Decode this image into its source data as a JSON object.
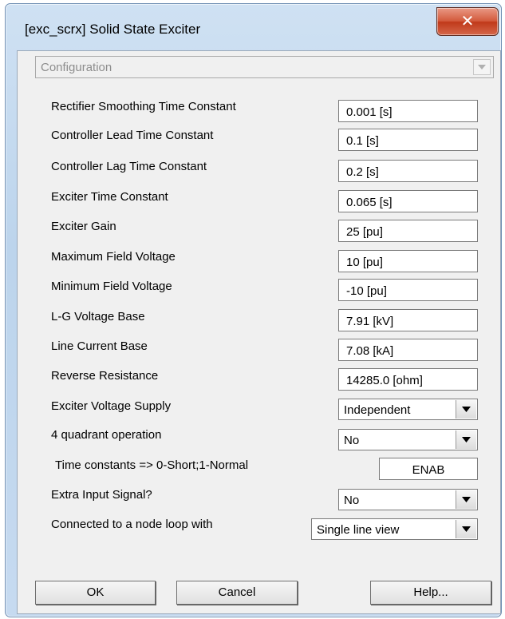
{
  "window": {
    "title": "[exc_scrx] Solid State Exciter",
    "close_glyph": "✕"
  },
  "config": {
    "label": "Configuration",
    "icon": "chevron-down-icon"
  },
  "params": [
    {
      "label": "Rectifier Smoothing Time Constant",
      "value": "0.001 [s]"
    },
    {
      "label": "Controller Lead Time Constant",
      "value": "0.1 [s]"
    },
    {
      "label": "Controller Lag Time Constant",
      "value": "0.2 [s]"
    },
    {
      "label": "Exciter Time Constant",
      "value": "0.065 [s]"
    },
    {
      "label": "Exciter Gain",
      "value": "25 [pu]"
    },
    {
      "label": "Maximum Field Voltage",
      "value": "10 [pu]"
    },
    {
      "label": "Minimum Field Voltage",
      "value": "-10 [pu]"
    },
    {
      "label": "L-G Voltage Base",
      "value": "7.91 [kV]"
    },
    {
      "label": "Line Current Base",
      "value": "7.08 [kA]"
    },
    {
      "label": "Reverse Resistance",
      "value": "14285.0 [ohm]"
    }
  ],
  "selects": {
    "exciter_voltage_supply": {
      "label": "Exciter Voltage Supply",
      "value": "Independent"
    },
    "four_quadrant": {
      "label": "4 quadrant operation",
      "value": "No"
    },
    "time_constants": {
      "label": "Time constants => 0-Short;1-Normal",
      "value": "ENAB"
    },
    "extra_input": {
      "label": "Extra Input Signal?",
      "value": "No"
    },
    "node_loop": {
      "label": "Connected to a node loop with",
      "value": "Single line view"
    }
  },
  "buttons": {
    "ok": "OK",
    "cancel": "Cancel",
    "help": "Help..."
  },
  "colors": {
    "frame": "#bcd4ec",
    "close": "#c8452a",
    "client": "#f0f0f0"
  }
}
